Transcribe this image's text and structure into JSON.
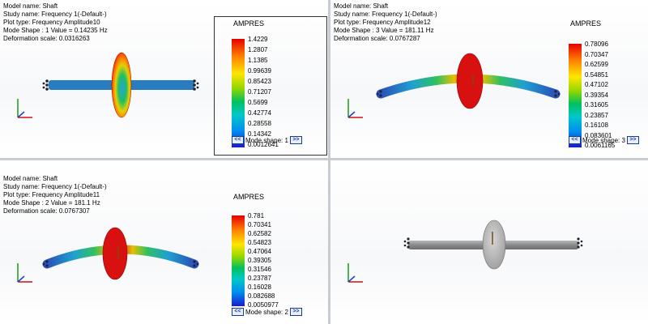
{
  "viewports": [
    {
      "model_name": "Model name: Shaft",
      "study_name": "Study name: Frequency 1(-Default-)",
      "plot_type": "Plot type: Frequency Amplitude10",
      "mode_shape": "Mode Shape : 1  Value =     0.14235 Hz",
      "deformation": "Deformation scale: 0.0316263",
      "legend_title": "AMPRES",
      "legend_values": [
        "1.4229",
        "1.2807",
        "1.1385",
        "0.99639",
        "0.85423",
        "0.71207",
        "0.5699",
        "0.42774",
        "0.28558",
        "0.14342",
        "0.0012641"
      ],
      "nav_prev": "<<",
      "nav_label": "Mode shape: 1",
      "nav_next": ">>"
    },
    {
      "model_name": "Model name: Shaft",
      "study_name": "Study name: Frequency 1(-Default-)",
      "plot_type": "Plot type: Frequency Amplitude12",
      "mode_shape": "Mode Shape : 3  Value =     181.11 Hz",
      "deformation": "Deformation scale: 0.0767287",
      "legend_title": "AMPRES",
      "legend_values": [
        "0.78096",
        "0.70347",
        "0.62599",
        "0.54851",
        "0.47102",
        "0.39354",
        "0.31605",
        "0.23857",
        "0.16108",
        "0.083601",
        "0.0061165"
      ],
      "nav_prev": "<<",
      "nav_label": "Mode shape: 3",
      "nav_next": ">>"
    },
    {
      "model_name": "Model name: Shaft",
      "study_name": "Study name: Frequency 1(-Default-)",
      "plot_type": "Plot type: Frequency Amplitude11",
      "mode_shape": "Mode Shape : 2  Value =     181.1 Hz",
      "deformation": "Deformation scale: 0.0767307",
      "legend_title": "AMPRES",
      "legend_values": [
        "0.781",
        "0.70341",
        "0.62582",
        "0.54823",
        "0.47064",
        "0.39305",
        "0.31546",
        "0.23787",
        "0.16028",
        "0.082688",
        "0.0050977"
      ],
      "nav_prev": "<<",
      "nav_label": "Mode shape: 2",
      "nav_next": ">>"
    }
  ],
  "colors": {
    "red": "#e01010",
    "blue": "#2a64b8",
    "gray": "#8c8c8c"
  }
}
